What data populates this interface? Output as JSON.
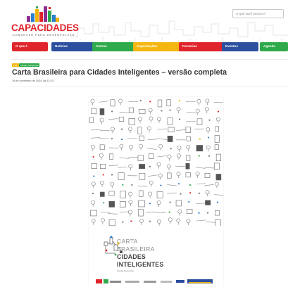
{
  "site": {
    "logo_text": "CAPACIDADES",
    "logo_subtitle": "CONHECER PARA DESENVOLVER",
    "logo_colors": [
      "#8b2f8f",
      "#e0242c",
      "#f4b400",
      "#2a7fcf",
      "#33a852"
    ]
  },
  "search": {
    "placeholder": "O que você procura?"
  },
  "nav": {
    "items": [
      {
        "label": "O que é",
        "color": "#e0242c"
      },
      {
        "label": "Notícias",
        "color": "#2c4f9e"
      },
      {
        "label": "Cursos",
        "color": "#2faa4a"
      },
      {
        "label": "Capacitações",
        "color": "#f5b70f"
      },
      {
        "label": "Parcerias",
        "color": "#e0242c"
      },
      {
        "label": "Eventos",
        "color": "#2c4f9e"
      },
      {
        "label": "Agenda",
        "color": "#2faa4a"
      }
    ]
  },
  "article": {
    "tags": [
      {
        "label": "PDF",
        "color": "#f5b70f"
      },
      {
        "label": "Cidades Inteligentes",
        "color": "#2faa4a"
      }
    ],
    "title": "Carta Brasileira para Cidades Inteligentes – versão completa",
    "date": "19 de novembro de 2024, às 12:23"
  },
  "cover": {
    "line1": "CARTA",
    "line2": "BRASILEIRA",
    "line3": "CIDADES",
    "line4": "INTELIGENTES",
    "edition": "Versão Resumida"
  }
}
